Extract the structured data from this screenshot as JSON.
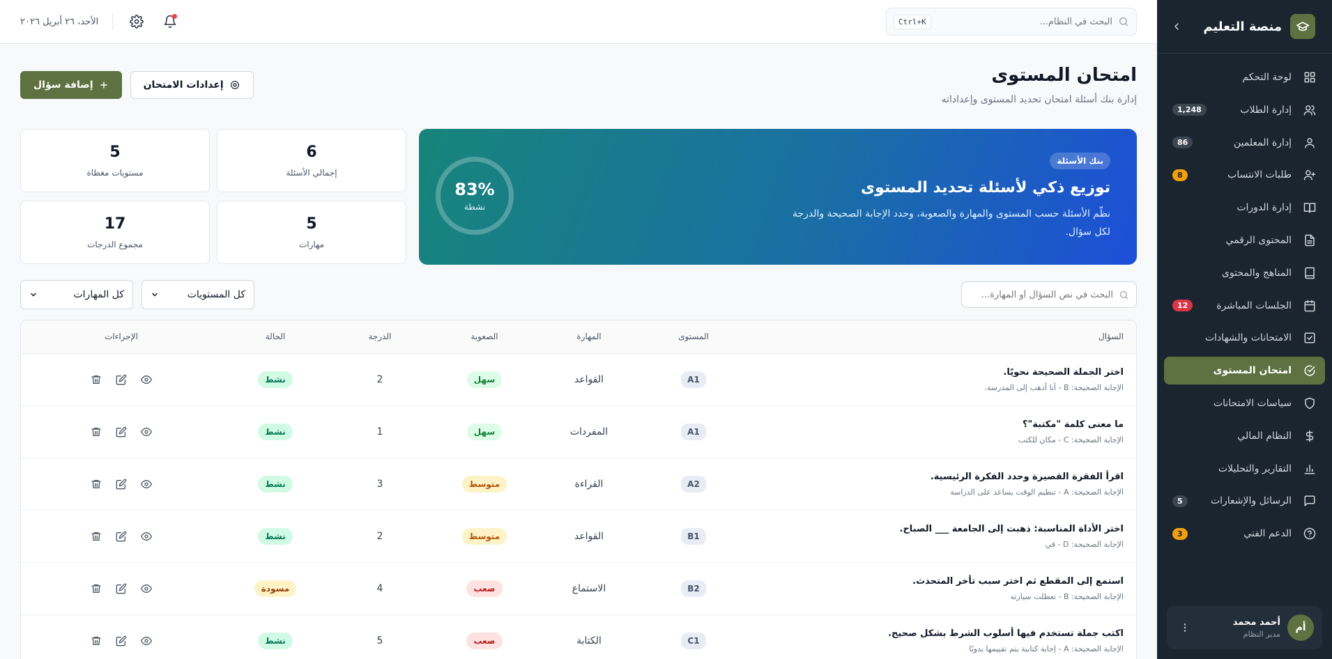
{
  "sidebar": {
    "title": "منصة التعليم",
    "items": [
      {
        "label": "لوحة التحكم",
        "icon": "grid-icon",
        "badge": "",
        "badge_style": ""
      },
      {
        "label": "إدارة الطلاب",
        "icon": "users-icon",
        "badge": "1,248",
        "badge_style": ""
      },
      {
        "label": "إدارة المعلمين",
        "icon": "user-icon",
        "badge": "86",
        "badge_style": ""
      },
      {
        "label": "طلبات الانتساب",
        "icon": "user-plus-icon",
        "badge": "8",
        "badge_style": "amber"
      },
      {
        "label": "إدارة الدورات",
        "icon": "book-open-icon",
        "badge": "",
        "badge_style": ""
      },
      {
        "label": "المحتوى الرقمي",
        "icon": "file-icon",
        "badge": "",
        "badge_style": ""
      },
      {
        "label": "المناهج والمحتوى",
        "icon": "book-icon",
        "badge": "",
        "badge_style": ""
      },
      {
        "label": "الجلسات المباشرة",
        "icon": "calendar-icon",
        "badge": "12",
        "badge_style": "red"
      },
      {
        "label": "الامتحانات والشهادات",
        "icon": "check-square-icon",
        "badge": "",
        "badge_style": ""
      },
      {
        "label": "امتحان المستوى",
        "icon": "check-circle-icon",
        "badge": "",
        "badge_style": "",
        "active": true
      },
      {
        "label": "سياسات الامتحانات",
        "icon": "shield-icon",
        "badge": "",
        "badge_style": ""
      },
      {
        "label": "النظام المالي",
        "icon": "dollar-icon",
        "badge": "",
        "badge_style": ""
      },
      {
        "label": "التقارير والتحليلات",
        "icon": "bar-chart-icon",
        "badge": "",
        "badge_style": ""
      },
      {
        "label": "الرسائل والإشعارات",
        "icon": "message-icon",
        "badge": "5",
        "badge_style": ""
      },
      {
        "label": "الدعم الفني",
        "icon": "help-circle-icon",
        "badge": "3",
        "badge_style": "amber"
      }
    ],
    "user": {
      "initials": "أم",
      "name": "أحمد محمد",
      "role": "مدير النظام"
    }
  },
  "topbar": {
    "search_placeholder": "البحث في النظام...",
    "shortcut": "Ctrl+K",
    "date": "الأحد، ٢٦ أبريل ٢٠٢٦"
  },
  "page": {
    "title": "امتحان المستوى",
    "subtitle": "إدارة بنك أسئلة امتحان تحديد المستوى وإعداداته",
    "settings_button": "إعدادات الامتحان",
    "add_button": "إضافة سؤال"
  },
  "hero": {
    "pill": "بنك الأسئلة",
    "title": "توزيع ذكي لأسئلة تحديد المستوى",
    "description": "نظّم الأسئلة حسب المستوى والمهارة والصعوبة، وحدد الإجابة الصحيحة والدرجة لكل سؤال.",
    "ring_value": "83%",
    "ring_label": "نشطة",
    "ring_fraction": 0.83
  },
  "stats": [
    {
      "value": "6",
      "label": "إجمالي الأسئلة"
    },
    {
      "value": "5",
      "label": "مستويات مغطاة"
    },
    {
      "value": "5",
      "label": "مهارات"
    },
    {
      "value": "17",
      "label": "مجموع الدرجات"
    }
  ],
  "filters": {
    "search_placeholder": "البحث في نص السؤال أو المهارة...",
    "levels_select": "كل المستويات",
    "skills_select": "كل المهارات"
  },
  "table": {
    "headers": {
      "question": "السؤال",
      "level": "المستوى",
      "skill": "المهارة",
      "difficulty": "الصعوبة",
      "score": "الدرجة",
      "status": "الحالة",
      "actions": "الإجراءات"
    },
    "rows": [
      {
        "question": "اختر الجملة الصحيحة نحويًا.",
        "answer": "الإجابة الصحيحة: B - أنا أذهب إلى المدرسة.",
        "level": "A1",
        "skill": "القواعد",
        "difficulty": "سهل",
        "difficulty_class": "d-easy",
        "score": "2",
        "status": "نشط",
        "status_class": "s-active"
      },
      {
        "question": "ما معنى كلمة \"مكتبة\"؟",
        "answer": "الإجابة الصحيحة: C - مكان للكتب",
        "level": "A1",
        "skill": "المفردات",
        "difficulty": "سهل",
        "difficulty_class": "d-easy",
        "score": "1",
        "status": "نشط",
        "status_class": "s-active"
      },
      {
        "question": "اقرأ الفقرة القصيرة وحدد الفكرة الرئيسية.",
        "answer": "الإجابة الصحيحة: A - تنظيم الوقت يساعد على الدراسة",
        "level": "A2",
        "skill": "القراءة",
        "difficulty": "متوسط",
        "difficulty_class": "d-mid",
        "score": "3",
        "status": "نشط",
        "status_class": "s-active"
      },
      {
        "question": "اختر الأداة المناسبة: ذهبت إلى الجامعة ___ الصباح.",
        "answer": "الإجابة الصحيحة: D - في",
        "level": "B1",
        "skill": "القواعد",
        "difficulty": "متوسط",
        "difficulty_class": "d-mid",
        "score": "2",
        "status": "نشط",
        "status_class": "s-active"
      },
      {
        "question": "استمع إلى المقطع ثم اختر سبب تأخر المتحدث.",
        "answer": "الإجابة الصحيحة: B - تعطلت سيارته",
        "level": "B2",
        "skill": "الاستماع",
        "difficulty": "صعب",
        "difficulty_class": "d-hard",
        "score": "4",
        "status": "مسودة",
        "status_class": "s-draft"
      },
      {
        "question": "اكتب جملة تستخدم فيها أسلوب الشرط بشكل صحيح.",
        "answer": "الإجابة الصحيحة: A - إجابة كتابية يتم تقييمها يدويًا",
        "level": "C1",
        "skill": "الكتابة",
        "difficulty": "صعب",
        "difficulty_class": "d-hard",
        "score": "5",
        "status": "نشط",
        "status_class": "s-active"
      }
    ]
  },
  "colors": {
    "accent": "#5e7140",
    "sidebar_bg": "#1a2530",
    "hero_from": "#17857a",
    "hero_to": "#1d4fd8"
  }
}
